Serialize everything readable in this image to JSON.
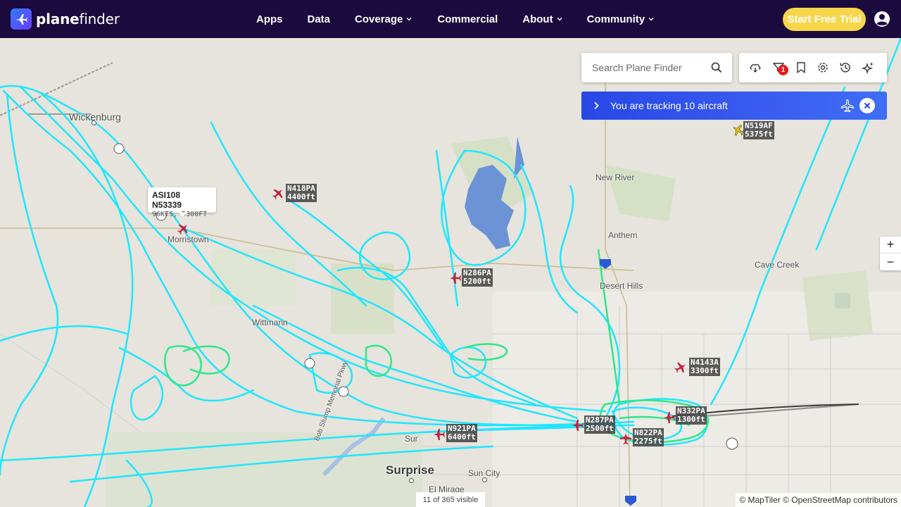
{
  "brand": {
    "name_prefix": "plane",
    "name_suffix": "finder"
  },
  "nav": [
    {
      "label": "Apps",
      "dropdown": false
    },
    {
      "label": "Data",
      "dropdown": false
    },
    {
      "label": "Coverage",
      "dropdown": true
    },
    {
      "label": "Commercial",
      "dropdown": false
    },
    {
      "label": "About",
      "dropdown": true
    },
    {
      "label": "Community",
      "dropdown": true
    }
  ],
  "trial_button": "Start Free Trial",
  "search": {
    "placeholder": "Search Plane Finder"
  },
  "toolbar": {
    "filter_badge": "1",
    "icons": [
      "weather-icon",
      "filter-icon",
      "bookmark-icon",
      "settings-icon",
      "history-icon",
      "sparkle-icon"
    ]
  },
  "tracking": {
    "text": "You are tracking 10 aircraft"
  },
  "places": {
    "wickenburg": "Wickenburg",
    "morristown": "Morristown",
    "wittmann": "Wittmann",
    "new_river": "New River",
    "anthem": "Anthem",
    "desert_hills": "Desert Hills",
    "cave_creek": "Cave Creek",
    "surprise": "Surprise",
    "sun_city": "Sun City",
    "el_mirage": "El Mirage",
    "sur": "Sur",
    "bob_stump": "Bob Stump Memorial Pkwy"
  },
  "selected_aircraft": {
    "callsign": "ASI108 N53339",
    "details": "96KTS, 5300FT"
  },
  "aircraft": [
    {
      "reg": "N519AF",
      "alt": "5375ft",
      "color": "#e2c31c"
    },
    {
      "reg": "N418PA",
      "alt": "4400ft",
      "color": "#c8213a"
    },
    {
      "reg": "N286PA",
      "alt": "5200ft",
      "color": "#c8213a"
    },
    {
      "reg": "N4143A",
      "alt": "3300ft",
      "color": "#c8213a"
    },
    {
      "reg": "N332PA",
      "alt": "1300ft",
      "color": "#c8213a"
    },
    {
      "reg": "N287PA",
      "alt": "2500ft",
      "color": "#c8213a"
    },
    {
      "reg": "N822PA",
      "alt": "2275ft",
      "color": "#c8213a"
    },
    {
      "reg": "N921PA",
      "alt": "6400ft",
      "color": "#c8213a"
    }
  ],
  "zoom": {
    "in": "+",
    "out": "−"
  },
  "visible_count": "11 of 365 visible",
  "attribution": "© MapTiler © OpenStreetMap contributors",
  "colors": {
    "nav_bg": "#1a0a3d",
    "trial": "#f7d64a",
    "track": "#1fe6ff",
    "track_low": "#2ee88a",
    "banner": "#2847e6"
  }
}
